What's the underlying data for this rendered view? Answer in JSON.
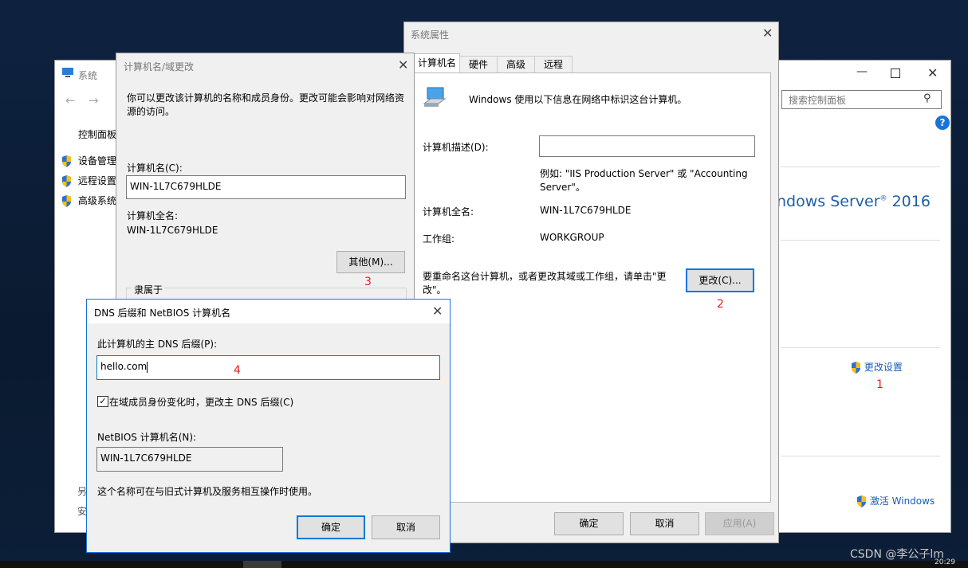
{
  "system_window": {
    "title": "系统",
    "search_placeholder": "搜索控制面板",
    "sidebar_home": "控制面板",
    "sidebar_items": [
      "设备管理",
      "远程设置",
      "高级系统"
    ],
    "brand": "ndows Server",
    "brand_version": "2016",
    "change_settings": "更改设置",
    "activate": "激活 Windows",
    "bottom_labels": [
      "另",
      "安"
    ],
    "annotation": "1"
  },
  "sys_props": {
    "title": "系统属性",
    "tabs": [
      "计算机名",
      "硬件",
      "高级",
      "远程"
    ],
    "intro": "Windows 使用以下信息在网络中标识这台计算机。",
    "desc_label": "计算机描述(D):",
    "desc_value": "",
    "example": "例如: \"IIS Production Server\" 或 \"Accounting",
    "example2": "Server\"。",
    "full_name_label": "计算机全名:",
    "full_name": "WIN-1L7C679HLDE",
    "workgroup_label": "工作组:",
    "workgroup": "WORKGROUP",
    "rename_text1": "要重命名这台计算机，或者更改其域或工作组，请单击\"更",
    "rename_text2": "改\"。",
    "change_btn": "更改(C)...",
    "annotation": "2",
    "ok": "确定",
    "cancel": "取消",
    "apply": "应用(A)"
  },
  "name_changes": {
    "title": "计算机名/域更改",
    "intro1": "你可以更改该计算机的名称和成员身份。更改可能会影响对网络资",
    "intro2": "源的访问。",
    "name_label": "计算机名(C):",
    "name_value": "WIN-1L7C679HLDE",
    "full_label": "计算机全名:",
    "full_value": "WIN-1L7C679HLDE",
    "more_btn": "其他(M)...",
    "annotation": "3",
    "member_of": "隶属于"
  },
  "dns_dialog": {
    "title": "DNS 后缀和 NetBIOS 计算机名",
    "suffix_label": "此计算机的主 DNS 后缀(P):",
    "suffix_value": "hello.com",
    "annotation": "4",
    "checkbox_label": "在域成员身份变化时，更改主 DNS 后缀(C)",
    "checkbox_checked": true,
    "netbios_label": "NetBIOS 计算机名(N):",
    "netbios_value": "WIN-1L7C679HLDE",
    "note": "这个名称可在与旧式计算机及服务相互操作时使用。",
    "ok": "确定",
    "cancel": "取消"
  },
  "watermark": "CSDN @李公子lm",
  "clock_partial": "20:29"
}
